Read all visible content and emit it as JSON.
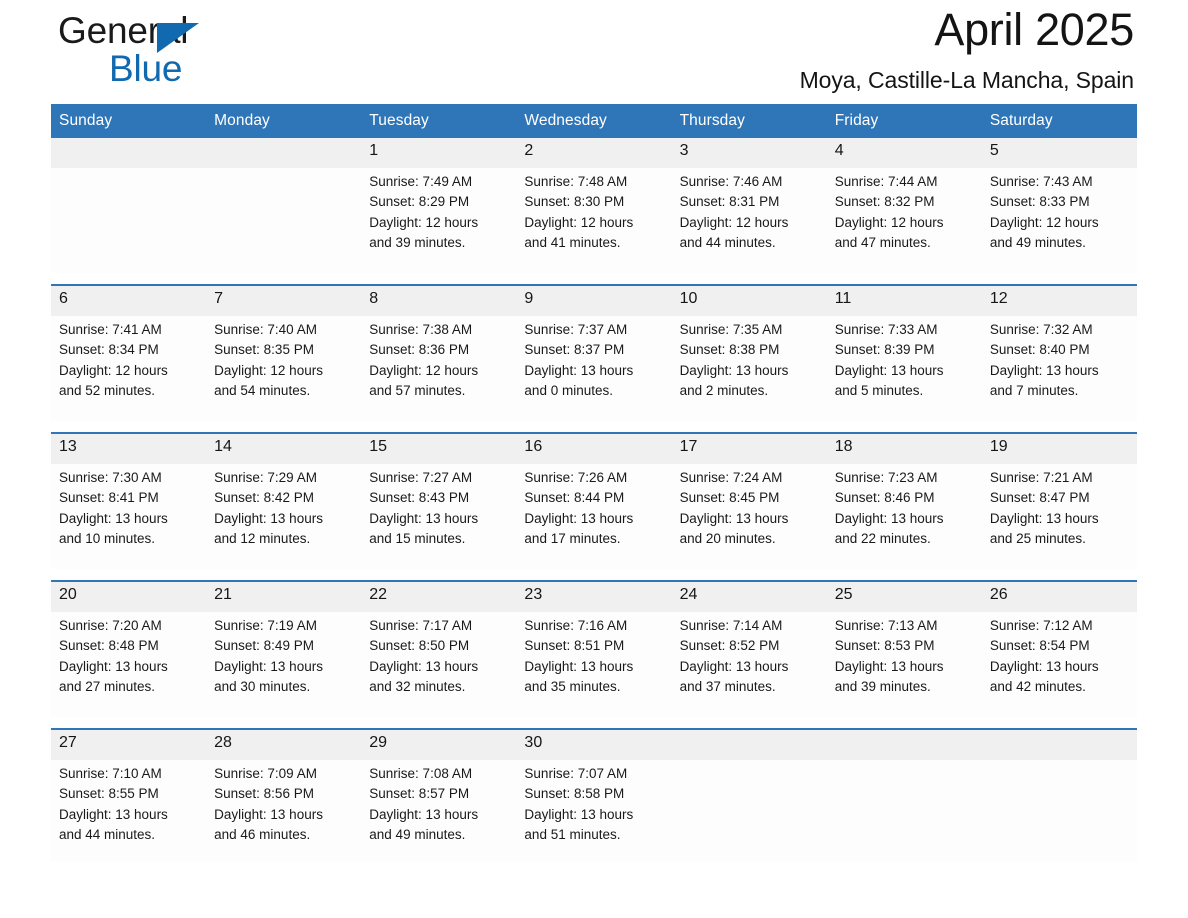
{
  "brand": {
    "name_part1": "General",
    "name_part2": "Blue",
    "accent_color": "#1169b0",
    "triangle_icon": "triangle-icon"
  },
  "header": {
    "title": "April 2025",
    "subtitle": "Moya, Castille-La Mancha, Spain"
  },
  "calendar": {
    "header_bg": "#2f76b8",
    "daynum_bg": "#f0f0f0",
    "weekdays": [
      "Sunday",
      "Monday",
      "Tuesday",
      "Wednesday",
      "Thursday",
      "Friday",
      "Saturday"
    ],
    "weeks": [
      {
        "days": [
          {
            "num": "",
            "sunrise": "",
            "sunset": "",
            "daylight_1": "",
            "daylight_2": ""
          },
          {
            "num": "",
            "sunrise": "",
            "sunset": "",
            "daylight_1": "",
            "daylight_2": ""
          },
          {
            "num": "1",
            "sunrise": "Sunrise: 7:49 AM",
            "sunset": "Sunset: 8:29 PM",
            "daylight_1": "Daylight: 12 hours",
            "daylight_2": "and 39 minutes."
          },
          {
            "num": "2",
            "sunrise": "Sunrise: 7:48 AM",
            "sunset": "Sunset: 8:30 PM",
            "daylight_1": "Daylight: 12 hours",
            "daylight_2": "and 41 minutes."
          },
          {
            "num": "3",
            "sunrise": "Sunrise: 7:46 AM",
            "sunset": "Sunset: 8:31 PM",
            "daylight_1": "Daylight: 12 hours",
            "daylight_2": "and 44 minutes."
          },
          {
            "num": "4",
            "sunrise": "Sunrise: 7:44 AM",
            "sunset": "Sunset: 8:32 PM",
            "daylight_1": "Daylight: 12 hours",
            "daylight_2": "and 47 minutes."
          },
          {
            "num": "5",
            "sunrise": "Sunrise: 7:43 AM",
            "sunset": "Sunset: 8:33 PM",
            "daylight_1": "Daylight: 12 hours",
            "daylight_2": "and 49 minutes."
          }
        ]
      },
      {
        "days": [
          {
            "num": "6",
            "sunrise": "Sunrise: 7:41 AM",
            "sunset": "Sunset: 8:34 PM",
            "daylight_1": "Daylight: 12 hours",
            "daylight_2": "and 52 minutes."
          },
          {
            "num": "7",
            "sunrise": "Sunrise: 7:40 AM",
            "sunset": "Sunset: 8:35 PM",
            "daylight_1": "Daylight: 12 hours",
            "daylight_2": "and 54 minutes."
          },
          {
            "num": "8",
            "sunrise": "Sunrise: 7:38 AM",
            "sunset": "Sunset: 8:36 PM",
            "daylight_1": "Daylight: 12 hours",
            "daylight_2": "and 57 minutes."
          },
          {
            "num": "9",
            "sunrise": "Sunrise: 7:37 AM",
            "sunset": "Sunset: 8:37 PM",
            "daylight_1": "Daylight: 13 hours",
            "daylight_2": "and 0 minutes."
          },
          {
            "num": "10",
            "sunrise": "Sunrise: 7:35 AM",
            "sunset": "Sunset: 8:38 PM",
            "daylight_1": "Daylight: 13 hours",
            "daylight_2": "and 2 minutes."
          },
          {
            "num": "11",
            "sunrise": "Sunrise: 7:33 AM",
            "sunset": "Sunset: 8:39 PM",
            "daylight_1": "Daylight: 13 hours",
            "daylight_2": "and 5 minutes."
          },
          {
            "num": "12",
            "sunrise": "Sunrise: 7:32 AM",
            "sunset": "Sunset: 8:40 PM",
            "daylight_1": "Daylight: 13 hours",
            "daylight_2": "and 7 minutes."
          }
        ]
      },
      {
        "days": [
          {
            "num": "13",
            "sunrise": "Sunrise: 7:30 AM",
            "sunset": "Sunset: 8:41 PM",
            "daylight_1": "Daylight: 13 hours",
            "daylight_2": "and 10 minutes."
          },
          {
            "num": "14",
            "sunrise": "Sunrise: 7:29 AM",
            "sunset": "Sunset: 8:42 PM",
            "daylight_1": "Daylight: 13 hours",
            "daylight_2": "and 12 minutes."
          },
          {
            "num": "15",
            "sunrise": "Sunrise: 7:27 AM",
            "sunset": "Sunset: 8:43 PM",
            "daylight_1": "Daylight: 13 hours",
            "daylight_2": "and 15 minutes."
          },
          {
            "num": "16",
            "sunrise": "Sunrise: 7:26 AM",
            "sunset": "Sunset: 8:44 PM",
            "daylight_1": "Daylight: 13 hours",
            "daylight_2": "and 17 minutes."
          },
          {
            "num": "17",
            "sunrise": "Sunrise: 7:24 AM",
            "sunset": "Sunset: 8:45 PM",
            "daylight_1": "Daylight: 13 hours",
            "daylight_2": "and 20 minutes."
          },
          {
            "num": "18",
            "sunrise": "Sunrise: 7:23 AM",
            "sunset": "Sunset: 8:46 PM",
            "daylight_1": "Daylight: 13 hours",
            "daylight_2": "and 22 minutes."
          },
          {
            "num": "19",
            "sunrise": "Sunrise: 7:21 AM",
            "sunset": "Sunset: 8:47 PM",
            "daylight_1": "Daylight: 13 hours",
            "daylight_2": "and 25 minutes."
          }
        ]
      },
      {
        "days": [
          {
            "num": "20",
            "sunrise": "Sunrise: 7:20 AM",
            "sunset": "Sunset: 8:48 PM",
            "daylight_1": "Daylight: 13 hours",
            "daylight_2": "and 27 minutes."
          },
          {
            "num": "21",
            "sunrise": "Sunrise: 7:19 AM",
            "sunset": "Sunset: 8:49 PM",
            "daylight_1": "Daylight: 13 hours",
            "daylight_2": "and 30 minutes."
          },
          {
            "num": "22",
            "sunrise": "Sunrise: 7:17 AM",
            "sunset": "Sunset: 8:50 PM",
            "daylight_1": "Daylight: 13 hours",
            "daylight_2": "and 32 minutes."
          },
          {
            "num": "23",
            "sunrise": "Sunrise: 7:16 AM",
            "sunset": "Sunset: 8:51 PM",
            "daylight_1": "Daylight: 13 hours",
            "daylight_2": "and 35 minutes."
          },
          {
            "num": "24",
            "sunrise": "Sunrise: 7:14 AM",
            "sunset": "Sunset: 8:52 PM",
            "daylight_1": "Daylight: 13 hours",
            "daylight_2": "and 37 minutes."
          },
          {
            "num": "25",
            "sunrise": "Sunrise: 7:13 AM",
            "sunset": "Sunset: 8:53 PM",
            "daylight_1": "Daylight: 13 hours",
            "daylight_2": "and 39 minutes."
          },
          {
            "num": "26",
            "sunrise": "Sunrise: 7:12 AM",
            "sunset": "Sunset: 8:54 PM",
            "daylight_1": "Daylight: 13 hours",
            "daylight_2": "and 42 minutes."
          }
        ]
      },
      {
        "days": [
          {
            "num": "27",
            "sunrise": "Sunrise: 7:10 AM",
            "sunset": "Sunset: 8:55 PM",
            "daylight_1": "Daylight: 13 hours",
            "daylight_2": "and 44 minutes."
          },
          {
            "num": "28",
            "sunrise": "Sunrise: 7:09 AM",
            "sunset": "Sunset: 8:56 PM",
            "daylight_1": "Daylight: 13 hours",
            "daylight_2": "and 46 minutes."
          },
          {
            "num": "29",
            "sunrise": "Sunrise: 7:08 AM",
            "sunset": "Sunset: 8:57 PM",
            "daylight_1": "Daylight: 13 hours",
            "daylight_2": "and 49 minutes."
          },
          {
            "num": "30",
            "sunrise": "Sunrise: 7:07 AM",
            "sunset": "Sunset: 8:58 PM",
            "daylight_1": "Daylight: 13 hours",
            "daylight_2": "and 51 minutes."
          },
          {
            "num": "",
            "sunrise": "",
            "sunset": "",
            "daylight_1": "",
            "daylight_2": ""
          },
          {
            "num": "",
            "sunrise": "",
            "sunset": "",
            "daylight_1": "",
            "daylight_2": ""
          },
          {
            "num": "",
            "sunrise": "",
            "sunset": "",
            "daylight_1": "",
            "daylight_2": ""
          }
        ]
      }
    ]
  }
}
